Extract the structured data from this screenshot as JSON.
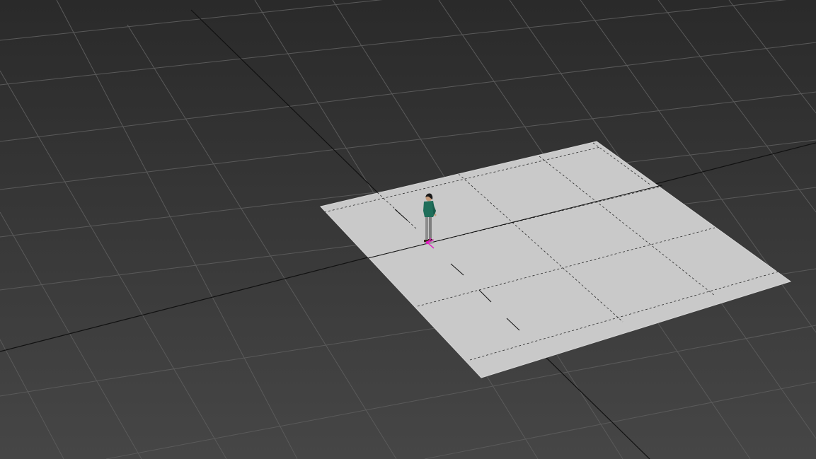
{
  "viewport": {
    "view": "perspective",
    "colors": {
      "background_far": "#2b2b2b",
      "background_near": "#444444",
      "grid_line": "#5a5a5a",
      "world_axis": "#111111",
      "plane_fill": "#c9c9c9",
      "plane_edge": "#d4d4d4",
      "plane_grid": "#222222",
      "character_shirt": "#1f6e5a",
      "character_pants": "#8c8c8c",
      "character_hair": "#1a1a1a",
      "gizmo": "#e020c0"
    },
    "objects": [
      {
        "name": "ground-plane",
        "segments": 3
      },
      {
        "name": "character",
        "selected": true
      }
    ]
  }
}
